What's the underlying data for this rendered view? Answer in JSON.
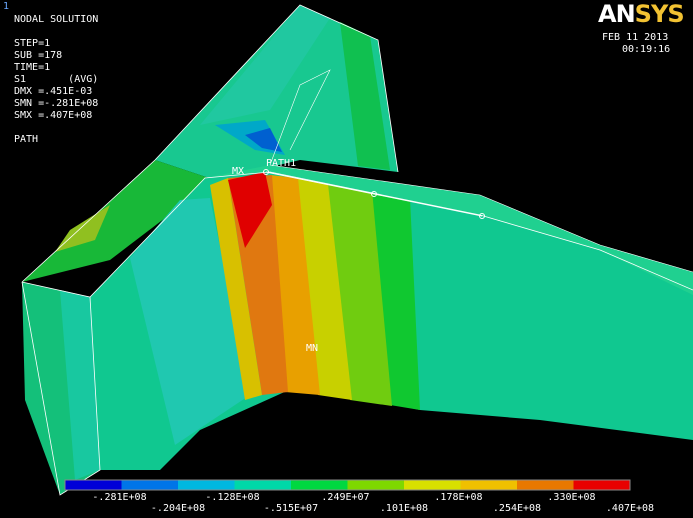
{
  "window_number": "1",
  "info": {
    "title": "NODAL SOLUTION",
    "step": "STEP=1",
    "sub": "SUB =178",
    "time": "TIME=1",
    "item": "S1       (AVG)",
    "dmx": "DMX =.451E-03",
    "smn": "SMN =-.281E+08",
    "smx": "SMX =.407E+08",
    "path_label": "PATH"
  },
  "logo": {
    "an": "AN",
    "sys": "SYS",
    "an_color": "#ffffff",
    "sys_color": "#f2c232"
  },
  "datetime": {
    "date": "FEB 11 2013",
    "time": "00:19:16"
  },
  "annotations": {
    "mx": "MX",
    "mn": "MN",
    "path1": "PATH1"
  },
  "legend": {
    "colors": [
      "#0000d8",
      "#0075e8",
      "#00b8e0",
      "#00d8a8",
      "#00d840",
      "#7ed800",
      "#d8e000",
      "#f0c000",
      "#e87800",
      "#e80000"
    ],
    "labels_top": [
      "-.281E+08",
      "-.128E+08",
      ".249E+07",
      ".178E+08",
      ".330E+08"
    ],
    "labels_bottom": [
      "-.204E+08",
      "-.515E+07",
      ".101E+08",
      ".254E+08",
      ".407E+08"
    ]
  }
}
